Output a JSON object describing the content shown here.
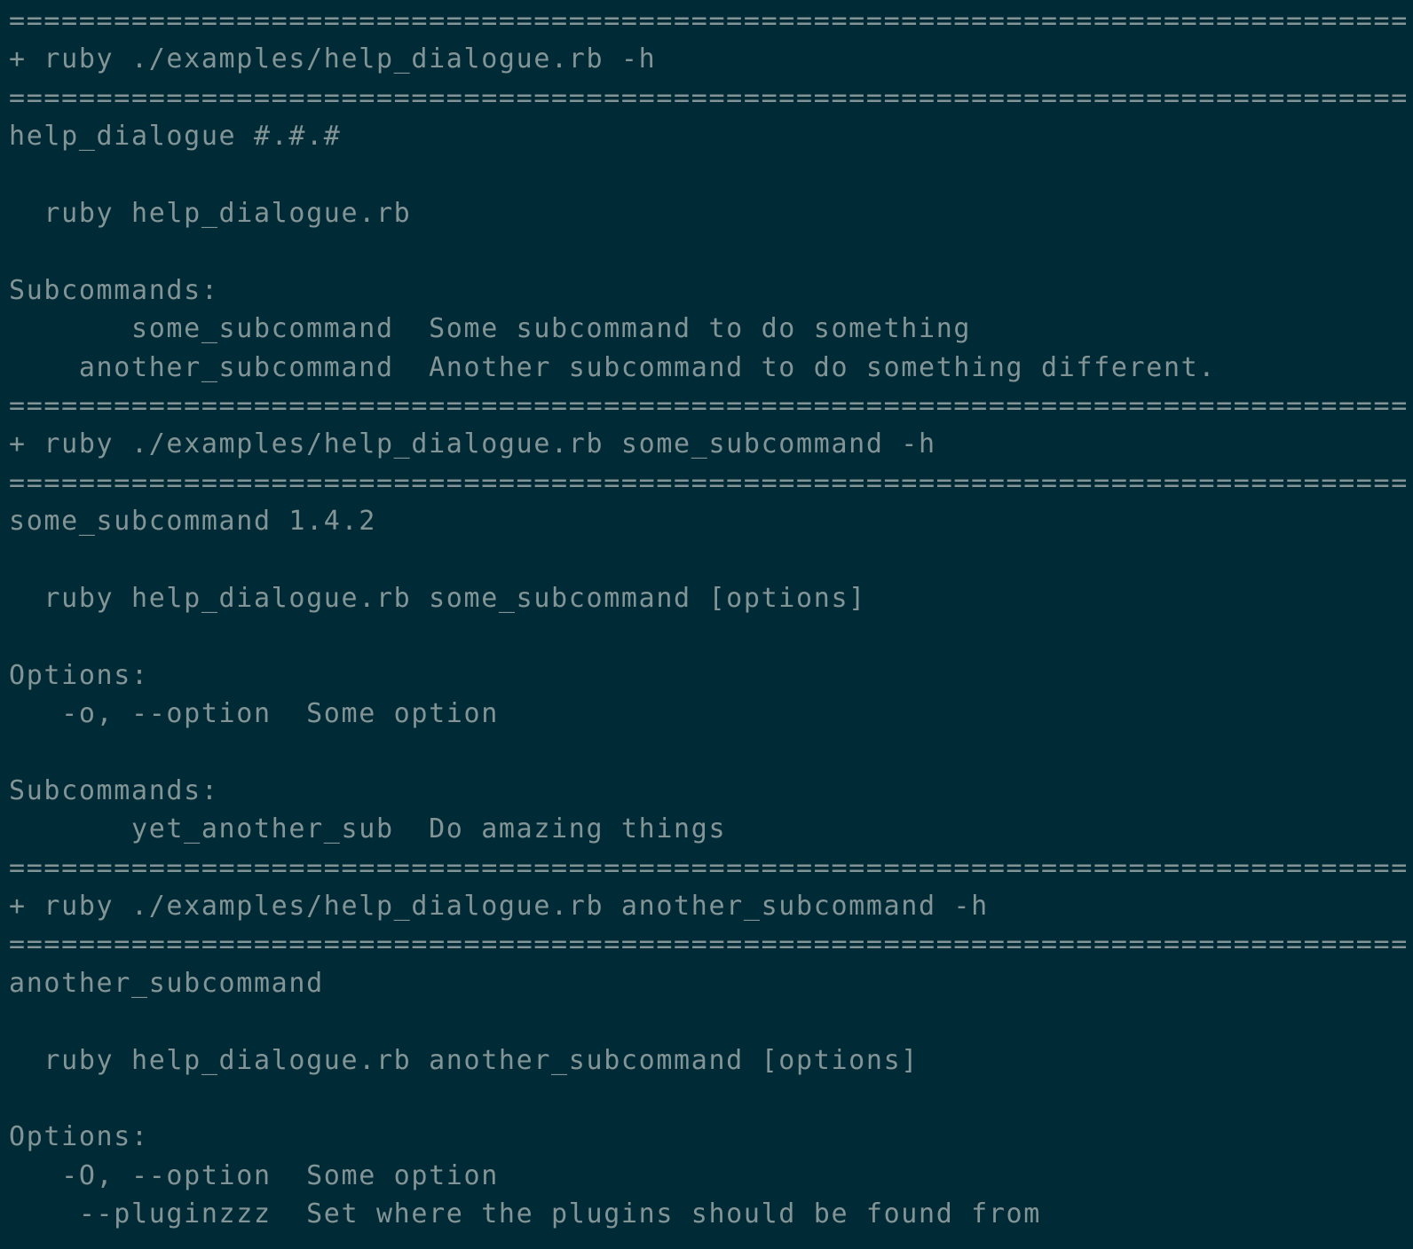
{
  "terminal": {
    "colors": {
      "background": "#002b36",
      "foreground": "#839496"
    },
    "separator": "================================================================================",
    "lines": [
      {
        "type": "separator"
      },
      {
        "type": "command",
        "text": "+ ruby ./examples/help_dialogue.rb -h"
      },
      {
        "type": "separator"
      },
      {
        "type": "output",
        "text": "help_dialogue #.#.#"
      },
      {
        "type": "output",
        "text": ""
      },
      {
        "type": "output",
        "text": "  ruby help_dialogue.rb"
      },
      {
        "type": "output",
        "text": ""
      },
      {
        "type": "output",
        "text": "Subcommands:"
      },
      {
        "type": "output",
        "text": "       some_subcommand  Some subcommand to do something"
      },
      {
        "type": "output",
        "text": "    another_subcommand  Another subcommand to do something different."
      },
      {
        "type": "separator"
      },
      {
        "type": "command",
        "text": "+ ruby ./examples/help_dialogue.rb some_subcommand -h"
      },
      {
        "type": "separator"
      },
      {
        "type": "output",
        "text": "some_subcommand 1.4.2"
      },
      {
        "type": "output",
        "text": ""
      },
      {
        "type": "output",
        "text": "  ruby help_dialogue.rb some_subcommand [options]"
      },
      {
        "type": "output",
        "text": ""
      },
      {
        "type": "output",
        "text": "Options:"
      },
      {
        "type": "output",
        "text": "   -o, --option  Some option"
      },
      {
        "type": "output",
        "text": ""
      },
      {
        "type": "output",
        "text": "Subcommands:"
      },
      {
        "type": "output",
        "text": "       yet_another_sub  Do amazing things"
      },
      {
        "type": "separator"
      },
      {
        "type": "command",
        "text": "+ ruby ./examples/help_dialogue.rb another_subcommand -h"
      },
      {
        "type": "separator"
      },
      {
        "type": "output",
        "text": "another_subcommand"
      },
      {
        "type": "output",
        "text": ""
      },
      {
        "type": "output",
        "text": "  ruby help_dialogue.rb another_subcommand [options]"
      },
      {
        "type": "output",
        "text": ""
      },
      {
        "type": "output",
        "text": "Options:"
      },
      {
        "type": "output",
        "text": "   -O, --option  Some option"
      },
      {
        "type": "output",
        "text": "    --pluginzzz  Set where the plugins should be found from"
      }
    ]
  }
}
